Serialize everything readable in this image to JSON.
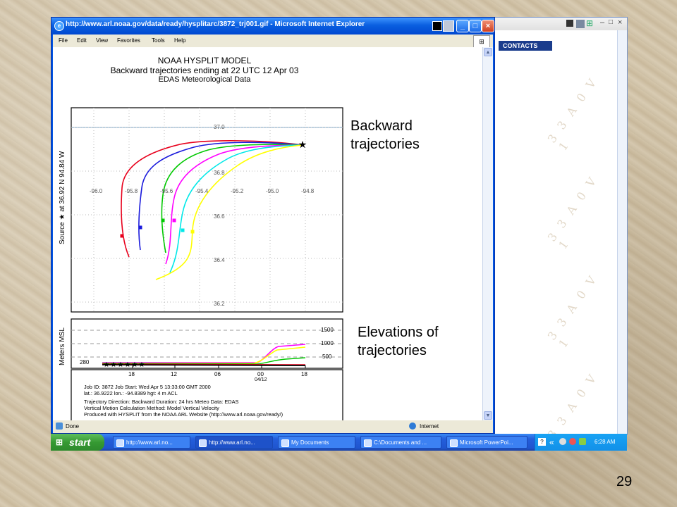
{
  "window": {
    "title": "http://www.arl.noaa.gov/data/ready/hysplitarc/3872_trj001.gif - Microsoft Internet Explorer",
    "menu": [
      "File",
      "Edit",
      "View",
      "Favorites",
      "Tools",
      "Help"
    ],
    "status": "Done",
    "zone": "Internet"
  },
  "background_window": {
    "contacts_label": "CONTACTS",
    "watermark": "3 3 A 0 V 1"
  },
  "plot": {
    "title_lines": [
      "NOAA HYSPLIT MODEL",
      "Backward trajectories ending at 22 UTC 12 Apr 03",
      "EDAS Meteorological Data"
    ],
    "source_label": "Source ★ at 36.92 N 94.84 W",
    "elev_label": "Meters MSL",
    "lat_ticks": [
      "37.0",
      "36.8",
      "36.6",
      "36.4",
      "36.2"
    ],
    "lon_ticks": [
      "-96.0",
      "-95.8",
      "-95.6",
      "-95.4",
      "-95.2",
      "-95.0",
      "-94.8"
    ],
    "elev_ticks": [
      "1500",
      "1000",
      "500"
    ],
    "elev_base": "280",
    "time_ticks": [
      "18",
      "12",
      "06",
      "00",
      "18"
    ],
    "time_date": "04/12",
    "info_lines": [
      "Job ID: 3872        Job Start: Wed Apr  5 13:33:00 GMT 2000",
      "lat.: 36.9222   lon.: -94.8389      hgt:  4 m ACL",
      "Trajectory Direction: Backward    Duration: 24 hrs    Meteo Data: EDAS",
      "Vertical Motion Calculation Method: Model Vertical Velocity",
      "Produced with HYSPLIT from the NOAA ARL Website (http://www.arl.noaa.gov/ready/)"
    ],
    "series_colors": [
      "#e8001c",
      "#1a1adc",
      "#00c800",
      "#ff00ff",
      "#00e8e8",
      "#ffff00"
    ]
  },
  "annotations": {
    "backward": [
      "Backward",
      "trajectories"
    ],
    "elevations": [
      "Elevations of",
      "trajectories"
    ]
  },
  "taskbar": {
    "start": "start",
    "tasks": [
      "http://www.arl.no...",
      "http://www.arl.no...",
      "My Documents",
      "C:\\Documents and ...",
      "Microsoft PowerPoi..."
    ],
    "clock": "6:28 AM"
  },
  "page_number": "29"
}
